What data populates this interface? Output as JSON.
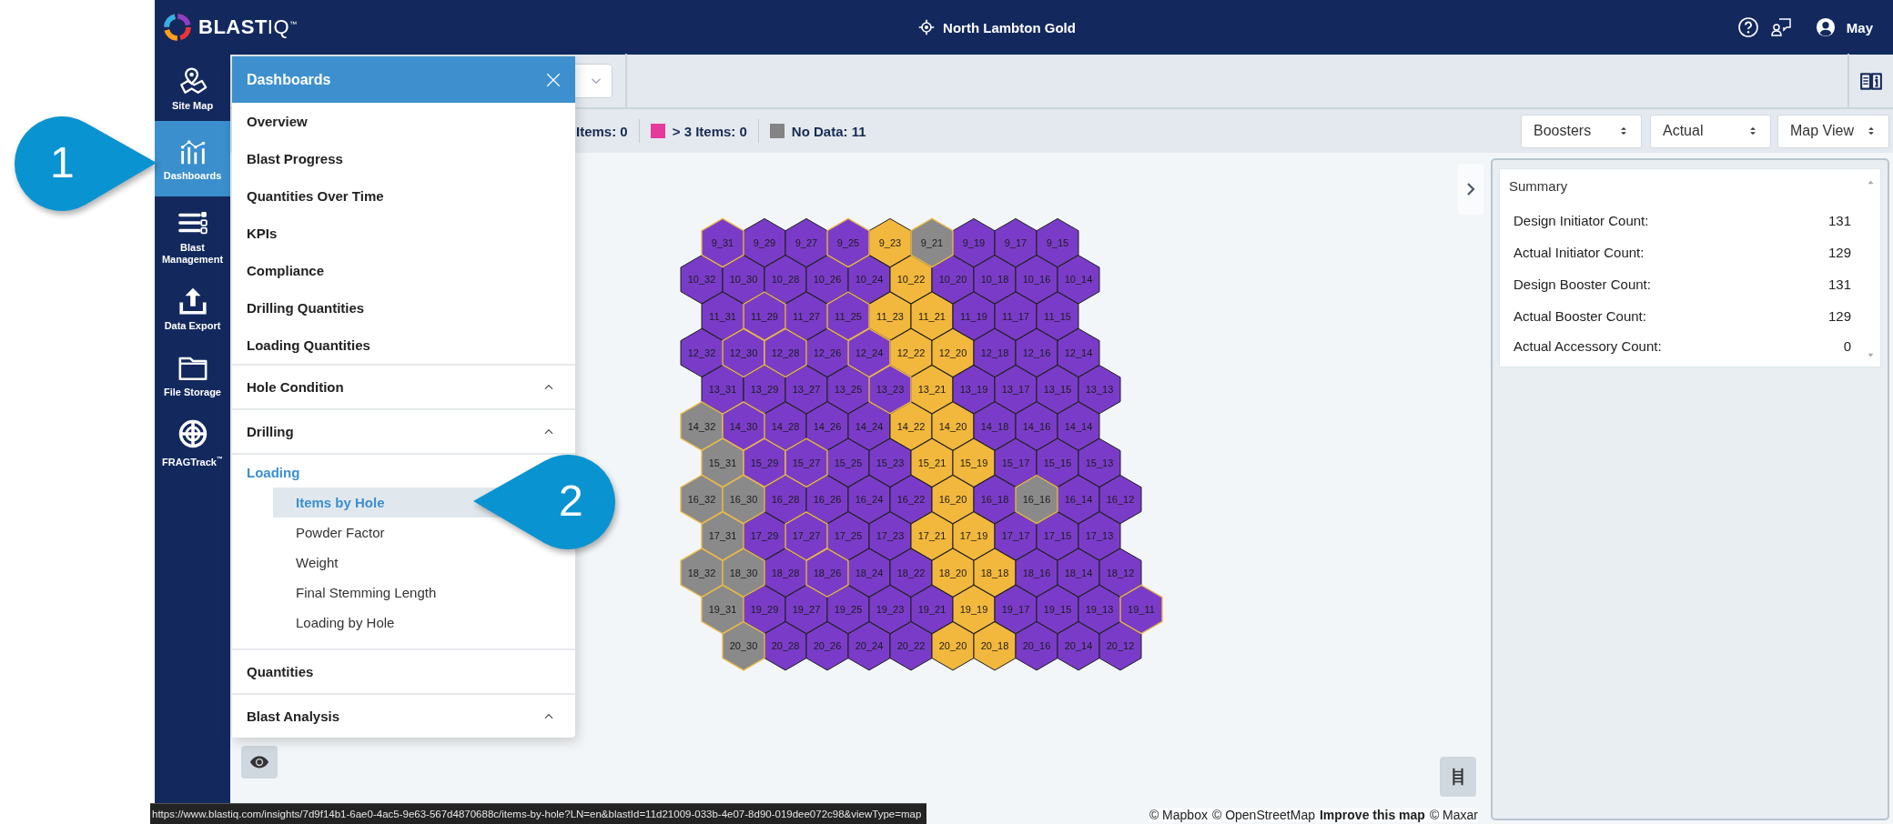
{
  "topbar": {
    "logo": "**BLAST**IQ$^{™}$",
    "project": "North Lambton Gold",
    "user": "May"
  },
  "sidebar": {
    "items": [
      {
        "label": "Site Map",
        "selected": false
      },
      {
        "label": "Dashboards",
        "selected": true
      },
      {
        "label": "Blast Management",
        "selected": false
      },
      {
        "label": "Data Export",
        "selected": false
      },
      {
        "label": "File Storage",
        "selected": false
      },
      {
        "label": "FRAGTrack$^{™}$",
        "selected": false
      }
    ]
  },
  "menu": {
    "title": "Dashboards",
    "items": [
      {
        "kind": "link",
        "label": "Overview",
        "selected": false
      },
      {
        "kind": "link",
        "label": "Blast Progress",
        "selected": false
      },
      {
        "kind": "link",
        "label": "Quantities Over Time",
        "selected": false
      },
      {
        "kind": "link",
        "label": "KPIs",
        "selected": false
      },
      {
        "kind": "link",
        "label": "Compliance",
        "selected": false
      },
      {
        "kind": "link",
        "label": "Drilling Quantities",
        "selected": false
      },
      {
        "kind": "link",
        "label": "Loading Quantities",
        "selected": false
      },
      {
        "kind": "group",
        "label": "Hole Condition",
        "expanded": false,
        "selected": false
      },
      {
        "kind": "group",
        "label": "Drilling",
        "expanded": false,
        "selected": false
      },
      {
        "kind": "group",
        "label": "Loading",
        "expanded": true,
        "selected": true,
        "children": [
          {
            "label": "Items by Hole",
            "selected": true
          },
          {
            "label": "Powder Factor",
            "selected": false
          },
          {
            "label": "Weight",
            "selected": false
          },
          {
            "label": "Final Stemming Length",
            "selected": false
          },
          {
            "label": "Loading by Hole",
            "selected": false
          }
        ]
      },
      {
        "kind": "heading",
        "label": "Quantities",
        "selected": false
      },
      {
        "kind": "group",
        "label": "Blast Analysis",
        "expanded": false,
        "selected": false
      }
    ]
  },
  "legend": [
    {
      "label": "Items: 0"
    },
    {
      "label": "> 3 Items: 0",
      "color": "#e5399b"
    },
    {
      "label": "No Data: 11",
      "color": "#848484"
    }
  ],
  "filters": [
    {
      "value": "Boosters"
    },
    {
      "value": "Actual"
    },
    {
      "value": "Map View"
    }
  ],
  "map": {
    "rows": [
      {
        "cells": [
          {
            "label": "9_31",
            "color": "#7a3cc8",
            "outlined": true
          },
          {
            "label": "9_29",
            "color": "#7a3cc8",
            "outlined": false
          },
          {
            "label": "9_27",
            "color": "#7a3cc8",
            "outlined": false
          },
          {
            "label": "9_25",
            "color": "#7a3cc8",
            "outlined": true
          },
          {
            "label": "9_23",
            "color": "#f2b73d",
            "outlined": false
          },
          {
            "label": "9_21",
            "color": "#8a8a8a",
            "outlined": true
          },
          {
            "label": "9_19",
            "color": "#7a3cc8",
            "outlined": false
          },
          {
            "label": "9_17",
            "color": "#7a3cc8",
            "outlined": false
          },
          {
            "label": "9_15",
            "color": "#7a3cc8",
            "outlined": false
          }
        ]
      },
      {
        "cells": [
          {
            "label": "10_32",
            "color": "#7a3cc8",
            "outlined": false
          },
          {
            "label": "10_30",
            "color": "#7a3cc8",
            "outlined": false
          },
          {
            "label": "10_28",
            "color": "#7a3cc8",
            "outlined": false
          },
          {
            "label": "10_26",
            "color": "#7a3cc8",
            "outlined": false
          },
          {
            "label": "10_24",
            "color": "#7a3cc8",
            "outlined": false
          },
          {
            "label": "10_22",
            "color": "#f2b73d",
            "outlined": false
          },
          {
            "label": "10_20",
            "color": "#7a3cc8",
            "outlined": false
          },
          {
            "label": "10_18",
            "color": "#7a3cc8",
            "outlined": false
          },
          {
            "label": "10_16",
            "color": "#7a3cc8",
            "outlined": false
          },
          {
            "label": "10_14",
            "color": "#7a3cc8",
            "outlined": false
          }
        ]
      },
      {
        "cells": [
          {
            "label": "11_31",
            "color": "#7a3cc8",
            "outlined": false
          },
          {
            "label": "11_29",
            "color": "#7a3cc8",
            "outlined": true
          },
          {
            "label": "11_27",
            "color": "#7a3cc8",
            "outlined": false
          },
          {
            "label": "11_25",
            "color": "#7a3cc8",
            "outlined": true
          },
          {
            "label": "11_23",
            "color": "#f2b73d",
            "outlined": false
          },
          {
            "label": "11_21",
            "color": "#f2b73d",
            "outlined": false
          },
          {
            "label": "11_19",
            "color": "#7a3cc8",
            "outlined": false
          },
          {
            "label": "11_17",
            "color": "#7a3cc8",
            "outlined": false
          },
          {
            "label": "11_15",
            "color": "#7a3cc8",
            "outlined": false
          }
        ]
      },
      {
        "cells": [
          {
            "label": "12_32",
            "color": "#7a3cc8",
            "outlined": false
          },
          {
            "label": "12_30",
            "color": "#7a3cc8",
            "outlined": true
          },
          {
            "label": "12_28",
            "color": "#7a3cc8",
            "outlined": true
          },
          {
            "label": "12_26",
            "color": "#7a3cc8",
            "outlined": false
          },
          {
            "label": "12_24",
            "color": "#7a3cc8",
            "outlined": true
          },
          {
            "label": "12_22",
            "color": "#f2b73d",
            "outlined": false
          },
          {
            "label": "12_20",
            "color": "#f2b73d",
            "outlined": false
          },
          {
            "label": "12_18",
            "color": "#7a3cc8",
            "outlined": false
          },
          {
            "label": "12_16",
            "color": "#7a3cc8",
            "outlined": false
          },
          {
            "label": "12_14",
            "color": "#7a3cc8",
            "outlined": false
          }
        ]
      },
      {
        "cells": [
          {
            "label": "13_31",
            "color": "#7a3cc8",
            "outlined": false
          },
          {
            "label": "13_29",
            "color": "#7a3cc8",
            "outlined": false
          },
          {
            "label": "13_27",
            "color": "#7a3cc8",
            "outlined": false
          },
          {
            "label": "13_25",
            "color": "#7a3cc8",
            "outlined": false
          },
          {
            "label": "13_23",
            "color": "#7a3cc8",
            "outlined": true
          },
          {
            "label": "13_21",
            "color": "#f2b73d",
            "outlined": false
          },
          {
            "label": "13_19",
            "color": "#7a3cc8",
            "outlined": false
          },
          {
            "label": "13_17",
            "color": "#7a3cc8",
            "outlined": false
          },
          {
            "label": "13_15",
            "color": "#7a3cc8",
            "outlined": false
          },
          {
            "label": "13_13",
            "color": "#7a3cc8",
            "outlined": false
          }
        ]
      },
      {
        "cells": [
          {
            "label": "14_32",
            "color": "#8a8a8a",
            "outlined": true
          },
          {
            "label": "14_30",
            "color": "#7a3cc8",
            "outlined": true
          },
          {
            "label": "14_28",
            "color": "#7a3cc8",
            "outlined": false
          },
          {
            "label": "14_26",
            "color": "#7a3cc8",
            "outlined": false
          },
          {
            "label": "14_24",
            "color": "#7a3cc8",
            "outlined": false
          },
          {
            "label": "14_22",
            "color": "#f2b73d",
            "outlined": false
          },
          {
            "label": "14_20",
            "color": "#f2b73d",
            "outlined": false
          },
          {
            "label": "14_18",
            "color": "#7a3cc8",
            "outlined": false
          },
          {
            "label": "14_16",
            "color": "#7a3cc8",
            "outlined": false
          },
          {
            "label": "14_14",
            "color": "#7a3cc8",
            "outlined": false
          }
        ]
      },
      {
        "cells": [
          {
            "label": "15_31",
            "color": "#8a8a8a",
            "outlined": true
          },
          {
            "label": "15_29",
            "color": "#7a3cc8",
            "outlined": true
          },
          {
            "label": "15_27",
            "color": "#7a3cc8",
            "outlined": true
          },
          {
            "label": "15_25",
            "color": "#7a3cc8",
            "outlined": false
          },
          {
            "label": "15_23",
            "color": "#7a3cc8",
            "outlined": false
          },
          {
            "label": "15_21",
            "color": "#f2b73d",
            "outlined": false
          },
          {
            "label": "15_19",
            "color": "#f2b73d",
            "outlined": false
          },
          {
            "label": "15_17",
            "color": "#7a3cc8",
            "outlined": false
          },
          {
            "label": "15_15",
            "color": "#7a3cc8",
            "outlined": false
          },
          {
            "label": "15_13",
            "color": "#7a3cc8",
            "outlined": false
          }
        ]
      },
      {
        "cells": [
          {
            "label": "16_32",
            "color": "#8a8a8a",
            "outlined": true
          },
          {
            "label": "16_30",
            "color": "#8a8a8a",
            "outlined": true
          },
          {
            "label": "16_28",
            "color": "#7a3cc8",
            "outlined": false
          },
          {
            "label": "16_26",
            "color": "#7a3cc8",
            "outlined": false
          },
          {
            "label": "16_24",
            "color": "#7a3cc8",
            "outlined": false
          },
          {
            "label": "16_22",
            "color": "#7a3cc8",
            "outlined": false
          },
          {
            "label": "16_20",
            "color": "#f2b73d",
            "outlined": false
          },
          {
            "label": "16_18",
            "color": "#7a3cc8",
            "outlined": false
          },
          {
            "label": "16_16",
            "color": "#8a8a8a",
            "outlined": true
          },
          {
            "label": "16_14",
            "color": "#7a3cc8",
            "outlined": false
          },
          {
            "label": "16_12",
            "color": "#7a3cc8",
            "outlined": false
          }
        ]
      },
      {
        "cells": [
          {
            "label": "17_31",
            "color": "#8a8a8a",
            "outlined": true
          },
          {
            "label": "17_29",
            "color": "#7a3cc8",
            "outlined": false
          },
          {
            "label": "17_27",
            "color": "#7a3cc8",
            "outlined": true
          },
          {
            "label": "17_25",
            "color": "#7a3cc8",
            "outlined": false
          },
          {
            "label": "17_23",
            "color": "#7a3cc8",
            "outlined": false
          },
          {
            "label": "17_21",
            "color": "#f2b73d",
            "outlined": false
          },
          {
            "label": "17_19",
            "color": "#f2b73d",
            "outlined": false
          },
          {
            "label": "17_17",
            "color": "#7a3cc8",
            "outlined": false
          },
          {
            "label": "17_15",
            "color": "#7a3cc8",
            "outlined": false
          },
          {
            "label": "17_13",
            "color": "#7a3cc8",
            "outlined": false
          }
        ]
      },
      {
        "cells": [
          {
            "label": "18_32",
            "color": "#8a8a8a",
            "outlined": true
          },
          {
            "label": "18_30",
            "color": "#8a8a8a",
            "outlined": true
          },
          {
            "label": "18_28",
            "color": "#7a3cc8",
            "outlined": false
          },
          {
            "label": "18_26",
            "color": "#7a3cc8",
            "outlined": true
          },
          {
            "label": "18_24",
            "color": "#7a3cc8",
            "outlined": false
          },
          {
            "label": "18_22",
            "color": "#7a3cc8",
            "outlined": false
          },
          {
            "label": "18_20",
            "color": "#f2b73d",
            "outlined": false
          },
          {
            "label": "18_18",
            "color": "#f2b73d",
            "outlined": false
          },
          {
            "label": "18_16",
            "color": "#7a3cc8",
            "outlined": false
          },
          {
            "label": "18_14",
            "color": "#7a3cc8",
            "outlined": false
          },
          {
            "label": "18_12",
            "color": "#7a3cc8",
            "outlined": false
          }
        ]
      },
      {
        "cells": [
          {
            "label": "19_31",
            "color": "#8a8a8a",
            "outlined": true
          },
          {
            "label": "19_29",
            "color": "#7a3cc8",
            "outlined": false
          },
          {
            "label": "19_27",
            "color": "#7a3cc8",
            "outlined": false
          },
          {
            "label": "19_25",
            "color": "#7a3cc8",
            "outlined": false
          },
          {
            "label": "19_23",
            "color": "#7a3cc8",
            "outlined": false
          },
          {
            "label": "19_21",
            "color": "#7a3cc8",
            "outlined": false
          },
          {
            "label": "19_19",
            "color": "#f2b73d",
            "outlined": false
          },
          {
            "label": "19_17",
            "color": "#7a3cc8",
            "outlined": false
          },
          {
            "label": "19_15",
            "color": "#7a3cc8",
            "outlined": false
          },
          {
            "label": "19_13",
            "color": "#7a3cc8",
            "outlined": false
          },
          {
            "label": "19_11",
            "color": "#7a3cc8",
            "outlined": true
          }
        ]
      },
      {
        "cells": [
          {
            "label": "20_30",
            "color": "#8a8a8a",
            "outlined": true
          },
          {
            "label": "20_28",
            "color": "#7a3cc8",
            "outlined": false
          },
          {
            "label": "20_26",
            "color": "#7a3cc8",
            "outlined": false
          },
          {
            "label": "20_24",
            "color": "#7a3cc8",
            "outlined": false
          },
          {
            "label": "20_22",
            "color": "#7a3cc8",
            "outlined": false
          },
          {
            "label": "20_20",
            "color": "#f2b73d",
            "outlined": false
          },
          {
            "label": "20_18",
            "color": "#f2b73d",
            "outlined": false
          },
          {
            "label": "20_16",
            "color": "#7a3cc8",
            "outlined": false
          },
          {
            "label": "20_14",
            "color": "#7a3cc8",
            "outlined": false
          },
          {
            "label": "20_12",
            "color": "#7a3cc8",
            "outlined": false
          }
        ]
      }
    ],
    "attribution": [
      {
        "text": "© Mapbox",
        "bold": false
      },
      {
        "text": "© OpenStreetMap",
        "bold": false
      },
      {
        "text": "Improve this map",
        "bold": true
      },
      {
        "text": "© Maxar",
        "bold": false
      }
    ]
  },
  "summary": {
    "title": "Summary",
    "rows": [
      {
        "label": "Design Initiator Count:",
        "value": "131"
      },
      {
        "label": "Actual Initiator Count:",
        "value": "129"
      },
      {
        "label": "Design Booster Count:",
        "value": "131"
      },
      {
        "label": "Actual Booster Count:",
        "value": "129"
      },
      {
        "label": "Actual Accessory Count:",
        "value": "0"
      }
    ]
  },
  "status_url": "https://www.blastiq.com/insights/7d9f14b1-6ae0-4ac5-9e63-567d4870688c/items-by-hole?LN=en&blastId=11d21009-033b-4e07-8d90-019dee072c98&viewType=map",
  "callouts": [
    {
      "label": "1"
    },
    {
      "label": "2"
    }
  ]
}
